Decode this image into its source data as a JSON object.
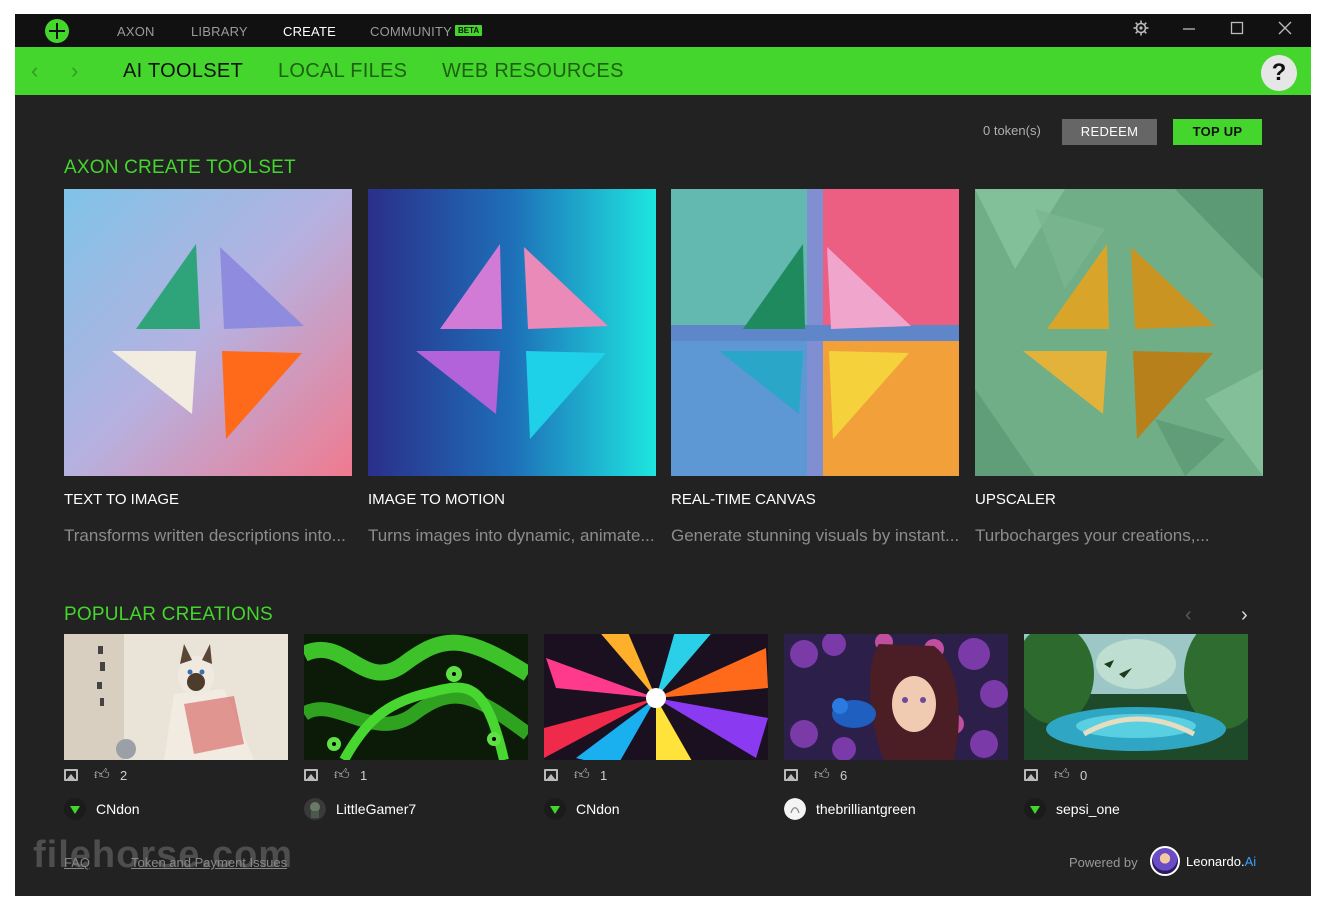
{
  "titlebar": {
    "tabs": [
      {
        "label": "AXON",
        "active": false
      },
      {
        "label": "LIBRARY",
        "active": false
      },
      {
        "label": "CREATE",
        "active": true
      },
      {
        "label": "COMMUNITY",
        "active": false
      }
    ],
    "beta_badge": "BETA",
    "icons": [
      "settings-icon",
      "minimize-icon",
      "maximize-icon",
      "close-icon"
    ]
  },
  "subnav": {
    "tabs": [
      {
        "label": "AI TOOLSET",
        "active": true
      },
      {
        "label": "LOCAL FILES",
        "active": false
      },
      {
        "label": "WEB RESOURCES",
        "active": false
      }
    ],
    "help_label": "?"
  },
  "tokens": {
    "balance_label": "0 token(s)",
    "redeem_label": "REDEEM",
    "topup_label": "TOP UP"
  },
  "toolset": {
    "title": "AXON CREATE TOOLSET",
    "cards": [
      {
        "title": "TEXT TO IMAGE",
        "desc": "Transforms written descriptions into..."
      },
      {
        "title": "IMAGE TO MOTION",
        "desc": "Turns images into dynamic, animate..."
      },
      {
        "title": "REAL-TIME CANVAS",
        "desc": "Generate stunning visuals by instant..."
      },
      {
        "title": "UPSCALER",
        "desc": "Turbocharges your creations,..."
      }
    ]
  },
  "popular": {
    "title": "POPULAR CREATIONS",
    "items": [
      {
        "likes": "2",
        "user": "CNdon"
      },
      {
        "likes": "1",
        "user": "LittleGamer7"
      },
      {
        "likes": "1",
        "user": "CNdon"
      },
      {
        "likes": "6",
        "user": "thebrilliantgreen"
      },
      {
        "likes": "0",
        "user": "sepsi_one"
      }
    ]
  },
  "footer": {
    "faq": "FAQ",
    "token_issues": "Token and Payment Issues",
    "powered_by": "Powered by",
    "brand_name": "Leonardo.",
    "brand_suffix": "Ai"
  },
  "watermark": "filehorse.com",
  "colors": {
    "accent": "#44d62c",
    "background": "#222222",
    "titlebar": "#111111"
  }
}
